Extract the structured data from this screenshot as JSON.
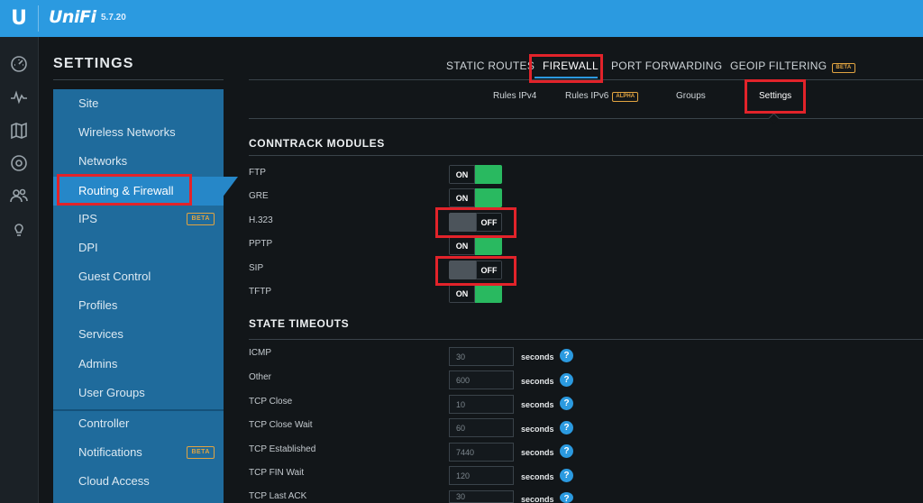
{
  "app": {
    "brand": "UniFi",
    "version": "5.7.20"
  },
  "rail": {
    "icons": [
      "dashboard-icon",
      "statistics-icon",
      "map-icon",
      "devices-icon",
      "clients-icon",
      "insights-icon"
    ]
  },
  "settings": {
    "title": "SETTINGS",
    "menu": [
      {
        "label": "Site"
      },
      {
        "label": "Wireless Networks"
      },
      {
        "label": "Networks"
      },
      {
        "label": "Routing & Firewall",
        "active": true
      },
      {
        "label": "IPS",
        "badge": "BETA"
      },
      {
        "label": "DPI"
      },
      {
        "label": "Guest Control"
      },
      {
        "label": "Profiles"
      },
      {
        "label": "Services"
      },
      {
        "label": "Admins"
      },
      {
        "label": "User Groups"
      },
      {
        "label": "Controller"
      },
      {
        "label": "Notifications",
        "badge": "BETA"
      },
      {
        "label": "Cloud Access"
      }
    ]
  },
  "tabs": [
    {
      "label": "STATIC ROUTES"
    },
    {
      "label": "FIREWALL",
      "active": true
    },
    {
      "label": "PORT FORWARDING"
    },
    {
      "label": "GEOIP FILTERING",
      "badge": "BETA"
    }
  ],
  "subtabs": [
    {
      "label": "Rules IPv4"
    },
    {
      "label": "Rules IPv6",
      "badge": "ALPHA"
    },
    {
      "label": "Groups"
    },
    {
      "label": "Settings",
      "active": true
    }
  ],
  "conntrack": {
    "title": "CONNTRACK MODULES",
    "modules": [
      {
        "label": "FTP",
        "state": "ON"
      },
      {
        "label": "GRE",
        "state": "ON"
      },
      {
        "label": "H.323",
        "state": "OFF"
      },
      {
        "label": "PPTP",
        "state": "ON"
      },
      {
        "label": "SIP",
        "state": "OFF"
      },
      {
        "label": "TFTP",
        "state": "ON"
      }
    ]
  },
  "timeouts": {
    "title": "STATE TIMEOUTS",
    "unit": "seconds",
    "help": "?",
    "rows": [
      {
        "label": "ICMP",
        "value": "30"
      },
      {
        "label": "Other",
        "value": "600"
      },
      {
        "label": "TCP Close",
        "value": "10"
      },
      {
        "label": "TCP Close Wait",
        "value": "60"
      },
      {
        "label": "TCP Established",
        "value": "7440"
      },
      {
        "label": "TCP FIN Wait",
        "value": "120"
      },
      {
        "label": "TCP Last ACK",
        "value": "30"
      }
    ]
  },
  "colors": {
    "topbar": "#2b9ae0",
    "menu": "#1f6b9c",
    "menu_active": "#2687c8",
    "toggle_on": "#29b960",
    "callout": "#e2232a",
    "badge": "#e1a441"
  }
}
